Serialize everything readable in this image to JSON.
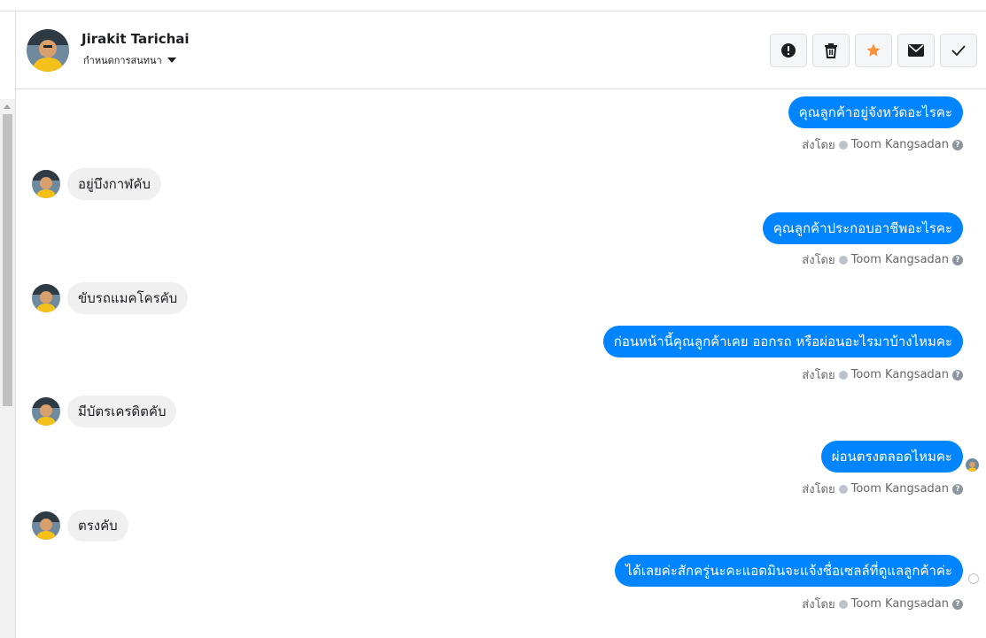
{
  "conversation": {
    "contact_name": "Jirakit Tarichai",
    "assign_label": "กำหนดการสนทนา",
    "avatar": "user-avatar-photo"
  },
  "toolbar": {
    "actions": [
      {
        "name": "report",
        "icon": "exclamation-circle-icon"
      },
      {
        "name": "delete",
        "icon": "trash-icon"
      },
      {
        "name": "star",
        "icon": "star-icon",
        "color": "#f7923b"
      },
      {
        "name": "mark-unread",
        "icon": "envelope-icon"
      },
      {
        "name": "done",
        "icon": "checkmark-icon"
      }
    ]
  },
  "messages": [
    {
      "dir": "out",
      "text": "คุณลูกค้าอยู่จังหวัดอะไรคะ",
      "sent_by_label": "ส่งโดย",
      "agent": "Toom Kangsadan"
    },
    {
      "dir": "in",
      "text": "อยู่บึงกาฬคับ"
    },
    {
      "dir": "out",
      "text": "คุณลูกค้าประกอบอาชีพอะไรคะ",
      "sent_by_label": "ส่งโดย",
      "agent": "Toom Kangsadan"
    },
    {
      "dir": "in",
      "text": "ขับรถแมคโครคับ"
    },
    {
      "dir": "out",
      "text": "ก่อนหน้านี้คุณลูกค้าเคย ออกรถ หรือผ่อนอะไรมาบ้างไหมคะ",
      "sent_by_label": "ส่งโดย",
      "agent": "Toom Kangsadan"
    },
    {
      "dir": "in",
      "text": "มีบัตรเครดิตคับ"
    },
    {
      "dir": "out",
      "text": "ผ่อนตรงตลอดไหมคะ",
      "sent_by_label": "ส่งโดย",
      "agent": "Toom Kangsadan"
    },
    {
      "dir": "in",
      "text": "ตรงคับ"
    },
    {
      "dir": "out",
      "text": "ได้เลยค่ะสักครู่นะคะแอดมินจะแจ้งชื่อเซลล์ที่ดูแลลูกค้าค่ะ",
      "sent_by_label": "ส่งโดย",
      "agent": "Toom Kangsadan"
    }
  ],
  "colors": {
    "outgoing_bubble": "#0084ff",
    "incoming_bubble": "#f0f0f0",
    "star": "#f7923b"
  }
}
